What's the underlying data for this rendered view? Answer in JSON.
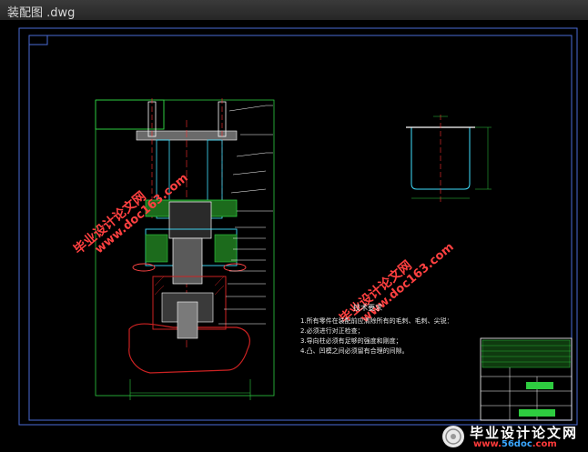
{
  "window": {
    "title": "装配图 .dwg"
  },
  "drawing": {
    "tech_requirements_title": "技术要求",
    "notes": [
      "1.所有零件在装配前应清除所有的毛刺、毛刺、尖锐：",
      "2.必须进行对正检查；",
      "3.导向柱必须有足够的强度和刚度；",
      "4.凸、凹模之间必须留有合理的间隙。"
    ]
  },
  "watermarks": {
    "cn": "毕业设计论文网",
    "url": "www.doc163.com"
  },
  "footer": {
    "brand": "毕业设计论文网",
    "url_prefix": "www.",
    "url_highlight": "56doc",
    "url_suffix": ".com"
  },
  "colors": {
    "frame": "#4a6bd6",
    "outline": "#2ecc40",
    "cyan": "#40e0ff",
    "white": "#ffffff",
    "watermark": "#ff4040"
  }
}
